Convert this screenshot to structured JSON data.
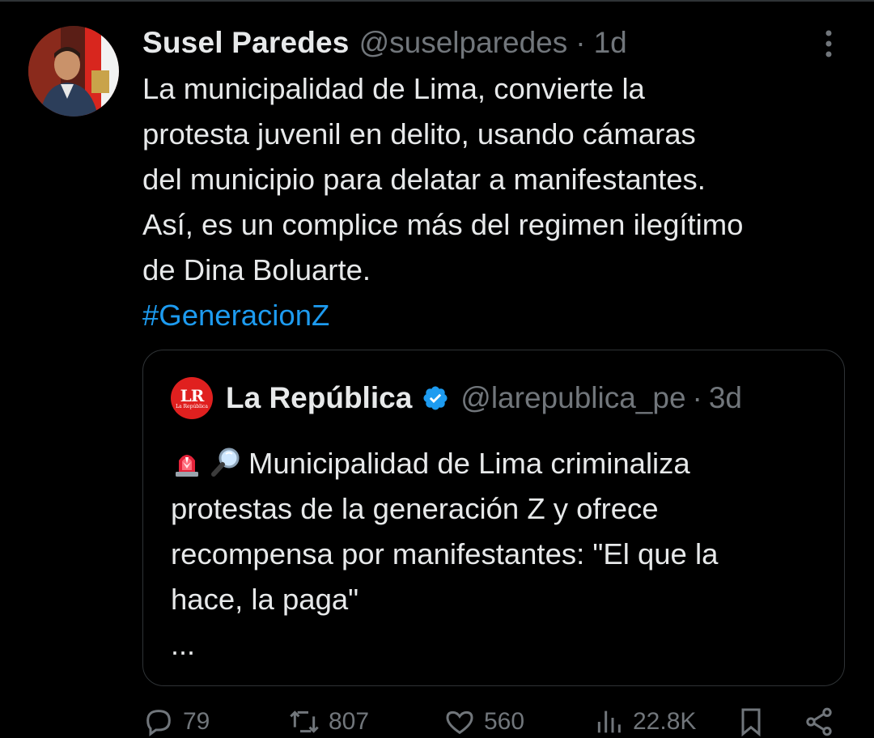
{
  "tweet": {
    "author_name": "Susel Paredes",
    "author_handle": "@suselparedes",
    "separator": "·",
    "time": "1d",
    "text_lines": [
      "La municipalidad de Lima, convierte la",
      "protesta juvenil en delito, usando cámaras",
      "del municipio para delatar a manifestantes.",
      "Así, es un complice más del regimen ilegítimo",
      "de Dina Boluarte."
    ],
    "hashtag": "#GeneracionZ",
    "more_icon": "more-vertical-icon"
  },
  "quote": {
    "author_name": "La República",
    "author_handle": "@larepublica_pe",
    "separator": "·",
    "time": "3d",
    "verified": true,
    "logo_text": "LR",
    "logo_subtext": "La República",
    "emojis": [
      "rotating-light-emoji",
      "magnifying-glass-emoji"
    ],
    "text_lines": [
      "Municipalidad de Lima criminaliza",
      "protestas de la generación Z y ofrece",
      "recompensa por manifestantes: \"El que la",
      "hace, la paga\""
    ],
    "ellipsis": "..."
  },
  "actions": [
    {
      "icon": "reply-icon",
      "count": "79"
    },
    {
      "icon": "repost-icon",
      "count": "807"
    },
    {
      "icon": "like-icon",
      "count": "560"
    },
    {
      "icon": "views-icon",
      "count": "22.8K"
    },
    {
      "icon": "bookmark-icon",
      "count": ""
    },
    {
      "icon": "share-icon",
      "count": ""
    }
  ],
  "colors": {
    "background": "#000000",
    "text": "#e7e9ea",
    "muted": "#71767b",
    "accent": "#1d9bf0",
    "border": "#2f3336",
    "lr_red": "#e0201f"
  }
}
